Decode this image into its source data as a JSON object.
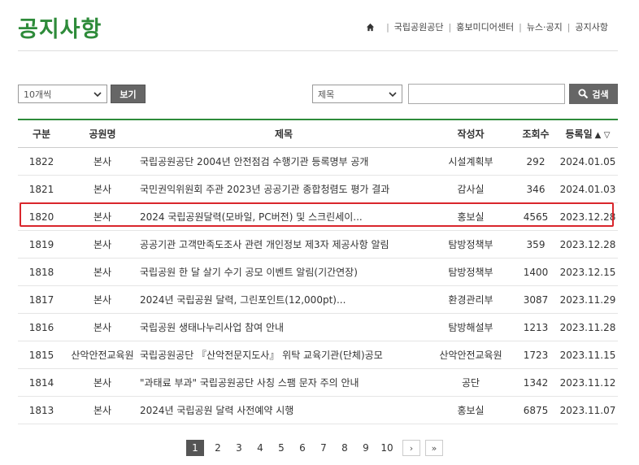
{
  "page": {
    "title": "공지사항"
  },
  "breadcrumb": {
    "items": [
      "국립공원공단",
      "홍보미디어센터",
      "뉴스·공지",
      "공지사항"
    ]
  },
  "controls": {
    "per_page": "10개씩",
    "view_label": "보기",
    "field_select": "제목",
    "search_value": "",
    "search_label": "검색"
  },
  "table": {
    "headers": {
      "no": "구분",
      "park": "공원명",
      "title": "제목",
      "author": "작성자",
      "views": "조회수",
      "date": "등록일"
    },
    "sort_glyphs": "▲ ▽",
    "rows": [
      {
        "no": "1822",
        "park": "본사",
        "title": "국립공원공단 2004년 안전점검 수행기관 등록명부 공개",
        "author": "시설계획부",
        "views": "292",
        "date": "2024.01.05"
      },
      {
        "no": "1821",
        "park": "본사",
        "title": "국민권익위원회 주관 2023년 공공기관 종합청렴도 평가 결과",
        "author": "감사실",
        "views": "346",
        "date": "2024.01.03"
      },
      {
        "no": "1820",
        "park": "본사",
        "title": "2024 국립공원달력(모바일, PC버전) 및 스크린세이...",
        "author": "홍보실",
        "views": "4565",
        "date": "2023.12.28"
      },
      {
        "no": "1819",
        "park": "본사",
        "title": "공공기관 고객만족도조사 관련 개인정보 제3자 제공사항 알림",
        "author": "탐방정책부",
        "views": "359",
        "date": "2023.12.28"
      },
      {
        "no": "1818",
        "park": "본사",
        "title": "국립공원 한 달 살기 수기 공모 이벤트 알림(기간연장)",
        "author": "탐방정책부",
        "views": "1400",
        "date": "2023.12.15"
      },
      {
        "no": "1817",
        "park": "본사",
        "title": "2024년 국립공원 달력, 그린포인트(12,000pt)...",
        "author": "환경관리부",
        "views": "3087",
        "date": "2023.11.29"
      },
      {
        "no": "1816",
        "park": "본사",
        "title": "국립공원 생태나누리사업 참여 안내",
        "author": "탐방해설부",
        "views": "1213",
        "date": "2023.11.28"
      },
      {
        "no": "1815",
        "park": "산악안전교육원",
        "title": "국립공원공단 『산악전문지도사』 위탁 교육기관(단체)공모",
        "author": "산악안전교육원",
        "views": "1723",
        "date": "2023.11.15"
      },
      {
        "no": "1814",
        "park": "본사",
        "title": "\"과태료 부과\" 국립공원공단 사칭 스팸 문자 주의 안내",
        "author": "공단",
        "views": "1342",
        "date": "2023.11.12"
      },
      {
        "no": "1813",
        "park": "본사",
        "title": "2024년 국립공원 달력 사전예약 시행",
        "author": "홍보실",
        "views": "6875",
        "date": "2023.11.07"
      }
    ]
  },
  "pagination": {
    "current": "1",
    "pages": [
      "2",
      "3",
      "4",
      "5",
      "6",
      "7",
      "8",
      "9",
      "10"
    ],
    "next": "›",
    "last": "»"
  },
  "colors": {
    "accent": "#2e8b3a",
    "highlight": "#d9262c",
    "button": "#666666"
  }
}
